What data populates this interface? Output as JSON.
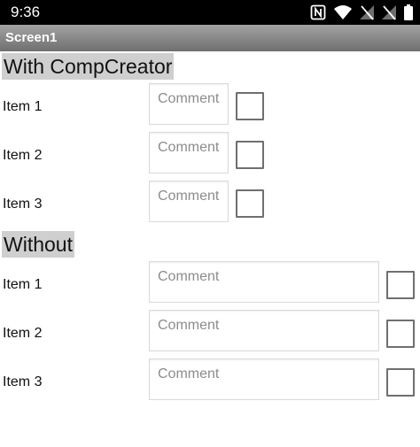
{
  "status_bar": {
    "time": "9:36",
    "icons": [
      "nfc-icon",
      "wifi-icon",
      "signal-off-icon",
      "signal-off-icon",
      "battery-icon"
    ]
  },
  "title_bar": {
    "title": "Screen1"
  },
  "sections": [
    {
      "title": "With CompCreator",
      "rows": [
        {
          "label": "Item 1",
          "placeholder": "Comment",
          "checked": false
        },
        {
          "label": "Item 2",
          "placeholder": "Comment",
          "checked": false
        },
        {
          "label": "Item 3",
          "placeholder": "Comment",
          "checked": false
        }
      ]
    },
    {
      "title": "Without",
      "rows": [
        {
          "label": "Item 1",
          "placeholder": "Comment",
          "checked": false
        },
        {
          "label": "Item 2",
          "placeholder": "Comment",
          "checked": false
        },
        {
          "label": "Item 3",
          "placeholder": "Comment",
          "checked": false
        }
      ]
    }
  ],
  "colors": {
    "status_bar_bg": "#000000",
    "title_bar_bg": "#8a8a8a",
    "section_header_bg": "#cfcfcf"
  }
}
